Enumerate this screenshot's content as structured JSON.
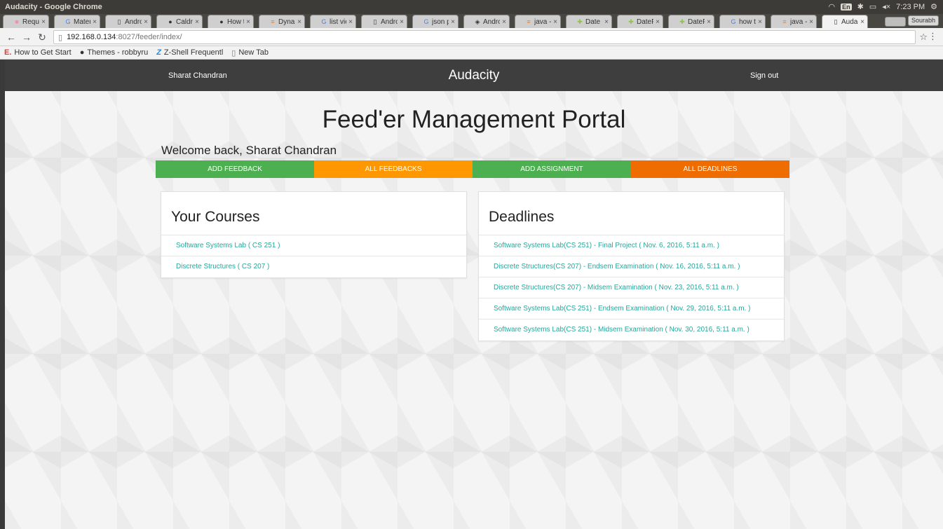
{
  "window": {
    "title": "Audacity - Google Chrome",
    "time": "7:23 PM",
    "lang": "En"
  },
  "tabs": [
    {
      "label": "Reque",
      "icon": "pink-square-icon"
    },
    {
      "label": "Materi",
      "icon": "google-icon"
    },
    {
      "label": "Andro",
      "icon": "page-icon"
    },
    {
      "label": "Caldro",
      "icon": "github-icon"
    },
    {
      "label": "How t",
      "icon": "github-icon"
    },
    {
      "label": "Dynam",
      "icon": "stackoverflow-icon"
    },
    {
      "label": "list vie",
      "icon": "google-icon"
    },
    {
      "label": "Andro",
      "icon": "page-icon"
    },
    {
      "label": "json p",
      "icon": "google-icon"
    },
    {
      "label": "Andro",
      "icon": "android-dev-icon"
    },
    {
      "label": "java - H",
      "icon": "stackoverflow-icon"
    },
    {
      "label": "Date |",
      "icon": "android-icon"
    },
    {
      "label": "DateF",
      "icon": "android-icon"
    },
    {
      "label": "DateF",
      "icon": "android-icon"
    },
    {
      "label": "how to",
      "icon": "google-icon"
    },
    {
      "label": "java - S",
      "icon": "stackoverflow-icon"
    },
    {
      "label": "Audac",
      "icon": "page-icon",
      "active": true
    }
  ],
  "profile_label": "Sourabh",
  "address": {
    "host": "192.168.0.134",
    "path": ":8027/feeder/index/"
  },
  "bookmarks": [
    {
      "label": "How to Get Start",
      "icon": "E."
    },
    {
      "label": "Themes - robbyru",
      "icon": "github-icon"
    },
    {
      "label": "Z-Shell Frequentl",
      "icon": "Z"
    },
    {
      "label": "New Tab",
      "icon": "page-icon"
    }
  ],
  "site": {
    "user": "Sharat Chandran",
    "brand": "Audacity",
    "signout": "Sign out",
    "title": "Feed'er Management Portal",
    "welcome": "Welcome back, Sharat Chandran"
  },
  "actions": [
    {
      "label": "ADD FEEDBACK",
      "color": "#4caf50"
    },
    {
      "label": "ALL FEEDBACKS",
      "color": "#ff9800"
    },
    {
      "label": "ADD ASSIGNMENT",
      "color": "#4caf50"
    },
    {
      "label": "ALL DEADLINES",
      "color": "#ef6c00"
    }
  ],
  "courses": {
    "heading": "Your Courses",
    "items": [
      "Software Systems Lab ( CS 251 )",
      "Discrete Structures ( CS 207 )"
    ]
  },
  "deadlines": {
    "heading": "Deadlines",
    "items": [
      "Software Systems Lab(CS 251) - Final Project ( Nov. 6, 2016, 5:11 a.m. )",
      "Discrete Structures(CS 207) - Endsem Examination ( Nov. 16, 2016, 5:11 a.m. )",
      "Discrete Structures(CS 207) - Midsem Examination ( Nov. 23, 2016, 5:11 a.m. )",
      "Software Systems Lab(CS 251) - Endsem Examination ( Nov. 29, 2016, 5:11 a.m. )",
      "Software Systems Lab(CS 251) - Midsem Examination ( Nov. 30, 2016, 5:11 a.m. )"
    ]
  },
  "colors": {
    "link": "#26a69a",
    "navbar": "#3e3e3e"
  }
}
